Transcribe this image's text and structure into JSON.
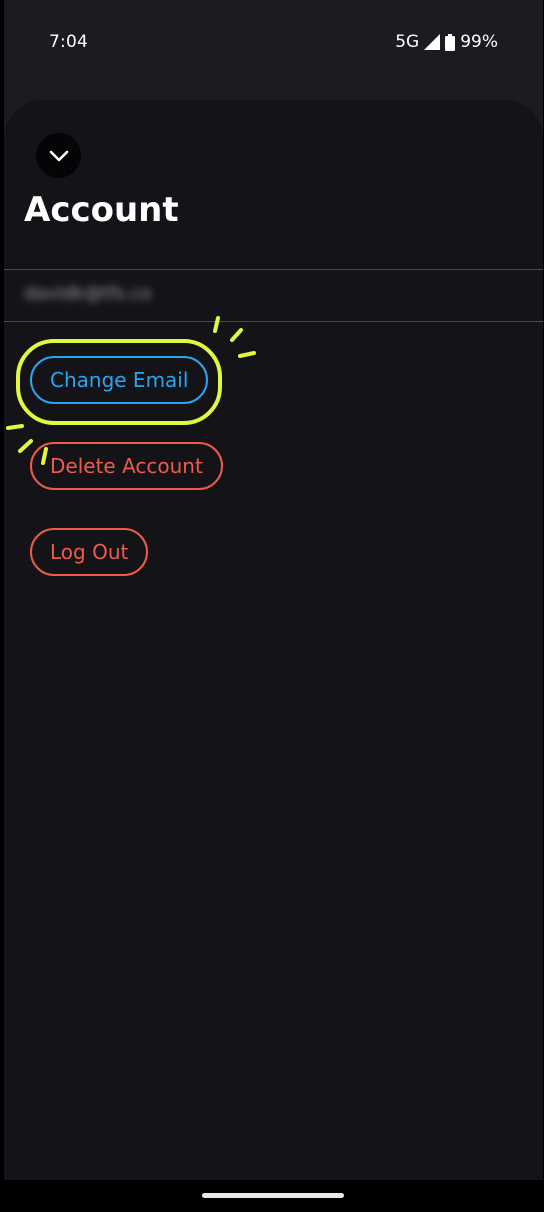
{
  "status_bar": {
    "time": "7:04",
    "network": "5G",
    "battery": "99%"
  },
  "sheet": {
    "collapse_icon": "chevron-down-icon",
    "title": "Account",
    "email": "davidk@tfs.co"
  },
  "actions": {
    "change_email": "Change Email",
    "delete_account": "Delete Account",
    "log_out": "Log Out"
  },
  "colors": {
    "accent_blue": "#2ba5f0",
    "danger_red": "#ee5b4b",
    "highlight_yellow": "#e2f741",
    "sheet_background": "#141418"
  }
}
